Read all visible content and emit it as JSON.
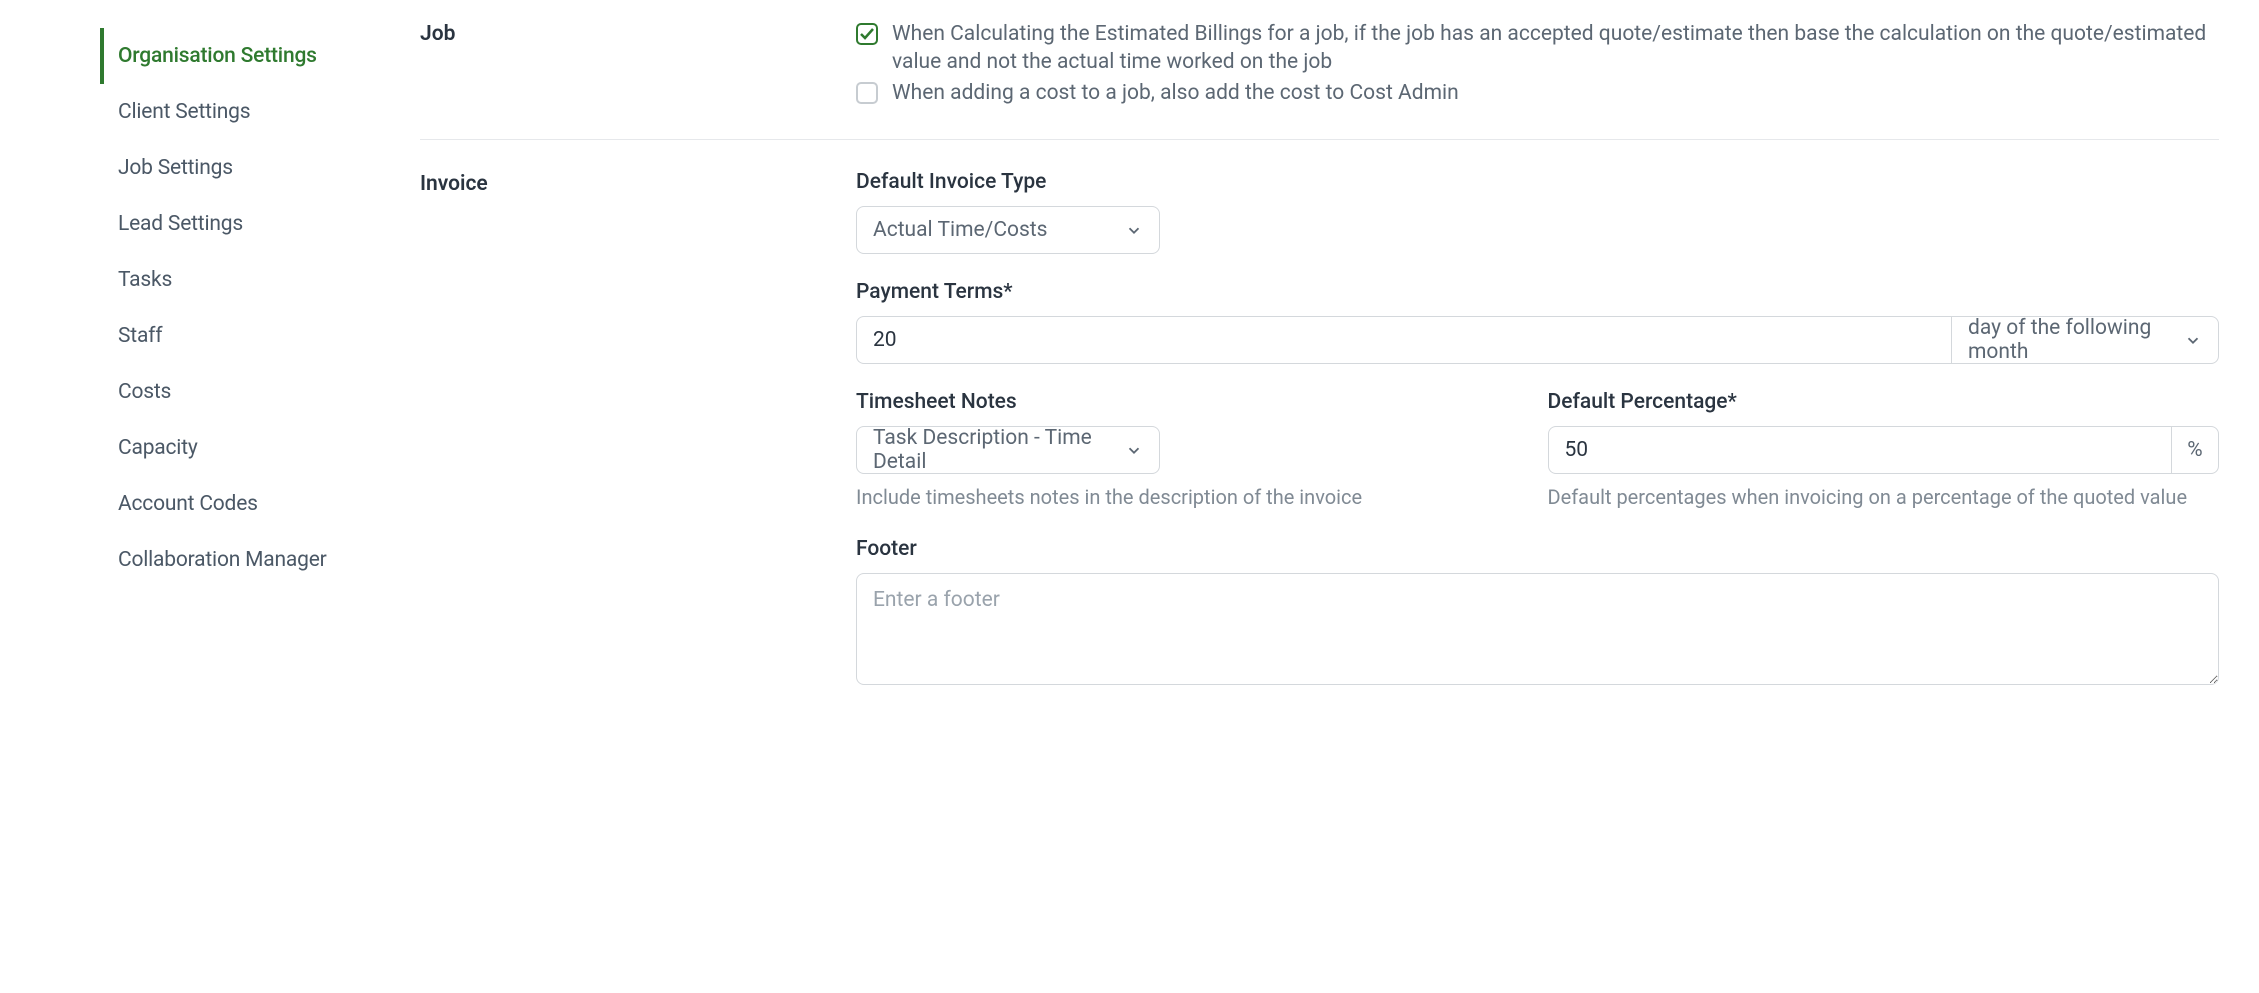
{
  "sidebar": {
    "items": [
      {
        "label": "Organisation Settings",
        "active": true
      },
      {
        "label": "Client Settings",
        "active": false
      },
      {
        "label": "Job Settings",
        "active": false
      },
      {
        "label": "Lead Settings",
        "active": false
      },
      {
        "label": "Tasks",
        "active": false
      },
      {
        "label": "Staff",
        "active": false
      },
      {
        "label": "Costs",
        "active": false
      },
      {
        "label": "Capacity",
        "active": false
      },
      {
        "label": "Account Codes",
        "active": false
      },
      {
        "label": "Collaboration Manager",
        "active": false
      }
    ]
  },
  "sections": {
    "job": {
      "title": "Job",
      "checkbox1": {
        "checked": true,
        "label": "When Calculating the Estimated Billings for a job, if the job has an accepted quote/estimate then base the calculation on the quote/estimated value and not the actual time worked on the job"
      },
      "checkbox2": {
        "checked": false,
        "label": "When adding a cost to a job, also add the cost to Cost Admin"
      }
    },
    "invoice": {
      "title": "Invoice",
      "defaultInvoiceType": {
        "label": "Default Invoice Type",
        "value": "Actual Time/Costs"
      },
      "paymentTerms": {
        "label": "Payment Terms*",
        "value": "20",
        "unit": "day of the following month"
      },
      "timesheetNotes": {
        "label": "Timesheet Notes",
        "value": "Task Description - Time Detail",
        "help": "Include timesheets notes in the description of the invoice"
      },
      "defaultPercentage": {
        "label": "Default Percentage*",
        "value": "50",
        "suffix": "%",
        "help": "Default percentages when invoicing on a percentage of the quoted value"
      },
      "footer": {
        "label": "Footer",
        "placeholder": "Enter a footer",
        "value": ""
      }
    }
  }
}
